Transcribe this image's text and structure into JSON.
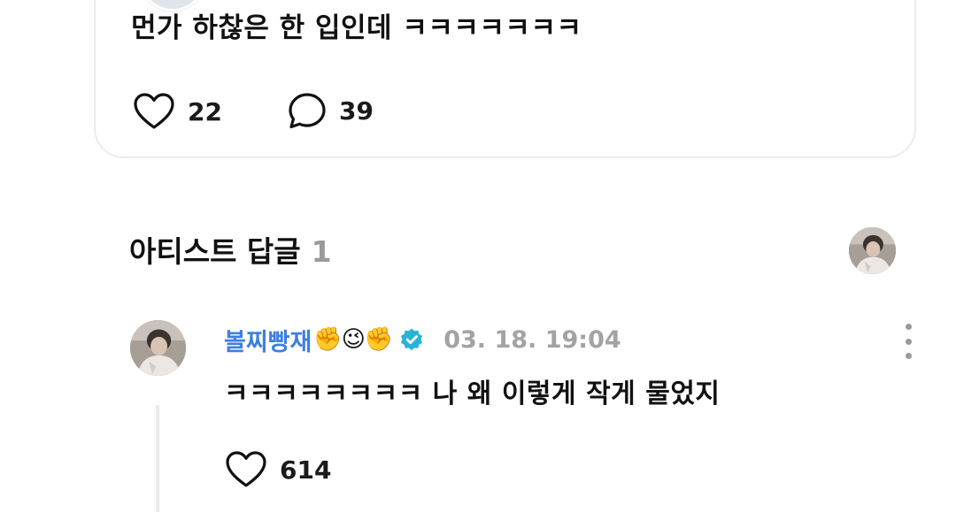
{
  "post": {
    "text": "먼가 하찮은 한 입인데 ㅋㅋㅋㅋㅋㅋㅋ",
    "like_count": "22",
    "comment_count": "39",
    "icons": {
      "like": "heart-icon",
      "comment": "speech-bubble-icon"
    }
  },
  "artist_replies": {
    "title": "아티스트 답글",
    "count": "1"
  },
  "reply": {
    "author": "볼찌빵재",
    "emojis": "✊😉✊",
    "verified_icon": "verified-badge-icon",
    "date": "03. 18. 19:04",
    "text": "ㅋㅋㅋㅋㅋㅋㅋㅋ 나 왜 이렇게 작게 물었지",
    "like_count": "614"
  },
  "colors": {
    "author": "#3d7fe0",
    "verified": "#27b4d6",
    "muted": "#9a9a9a",
    "card_border": "#ececec"
  }
}
